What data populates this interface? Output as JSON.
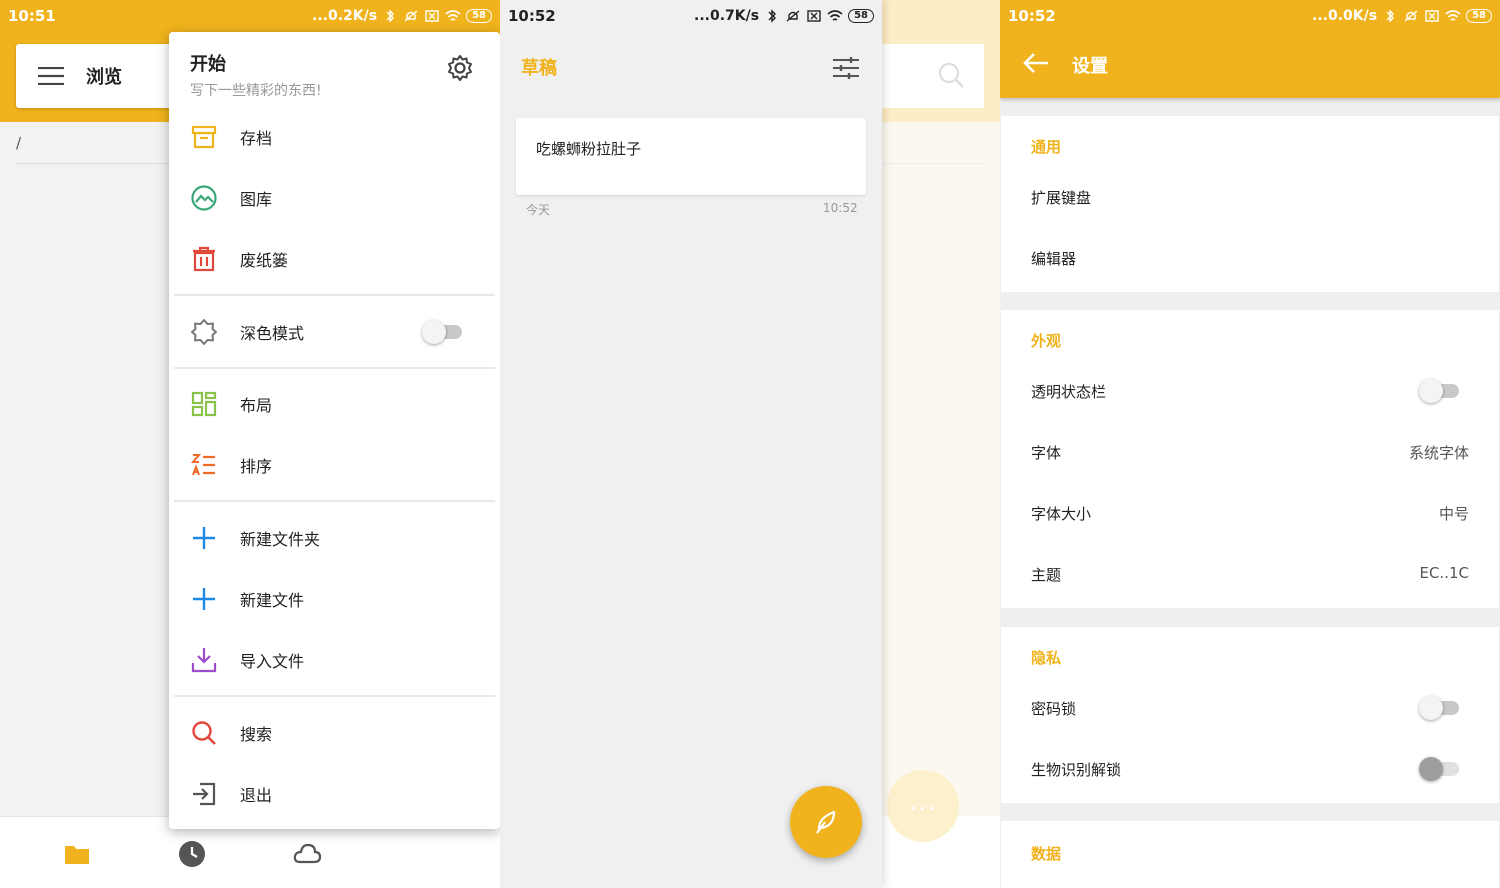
{
  "panel1": {
    "status": {
      "time": "10:51",
      "speed": "...0.2K/s",
      "battery": "58"
    },
    "header": {
      "title": "浏览"
    },
    "path": "/",
    "drawer": {
      "title": "开始",
      "subtitle": "写下一些精彩的东西!",
      "items": [
        {
          "label": "存档",
          "icon": "archive-icon",
          "color": "#f0b31d"
        },
        {
          "label": "图库",
          "icon": "gallery-icon",
          "color": "#3aa876"
        },
        {
          "label": "废纸篓",
          "icon": "trash-icon",
          "color": "#e0483c"
        },
        {
          "label": "深色模式",
          "icon": "brightness-icon",
          "color": "#777777"
        },
        {
          "label": "布局",
          "icon": "layout-icon",
          "color": "#8bc34a"
        },
        {
          "label": "排序",
          "icon": "sort-icon",
          "color": "#f06a28"
        },
        {
          "label": "新建文件夹",
          "icon": "plus-icon",
          "color": "#1e88e5"
        },
        {
          "label": "新建文件",
          "icon": "plus-icon",
          "color": "#1e88e5"
        },
        {
          "label": "导入文件",
          "icon": "import-icon",
          "color": "#9c4dcc"
        },
        {
          "label": "搜索",
          "icon": "search-icon",
          "color": "#e0483c"
        },
        {
          "label": "退出",
          "icon": "exit-icon",
          "color": "#555555"
        }
      ]
    }
  },
  "panel2": {
    "status": {
      "time": "10:52",
      "speed": "...0.7K/s",
      "battery": "58"
    },
    "title": "草稿",
    "note": {
      "text": "吃螺蛳粉拉肚子",
      "date": "今天",
      "time": "10:52"
    },
    "bg_fab_label": "..."
  },
  "panel3": {
    "status": {
      "time": "10:52",
      "speed": "...0.0K/s",
      "battery": "58"
    },
    "title": "设置",
    "sections": {
      "general": {
        "title": "通用",
        "items": [
          "扩展键盘",
          "编辑器"
        ]
      },
      "appearance": {
        "title": "外观",
        "items": [
          {
            "label": "透明状态栏",
            "value": ""
          },
          {
            "label": "字体",
            "value": "系统字体"
          },
          {
            "label": "字体大小",
            "value": "中号"
          },
          {
            "label": "主题",
            "value": "EC..1C"
          }
        ]
      },
      "privacy": {
        "title": "隐私",
        "items": [
          "密码锁",
          "生物识别解锁"
        ]
      },
      "data": {
        "title": "数据"
      }
    }
  },
  "colors": {
    "accent": "#f0b31d"
  }
}
